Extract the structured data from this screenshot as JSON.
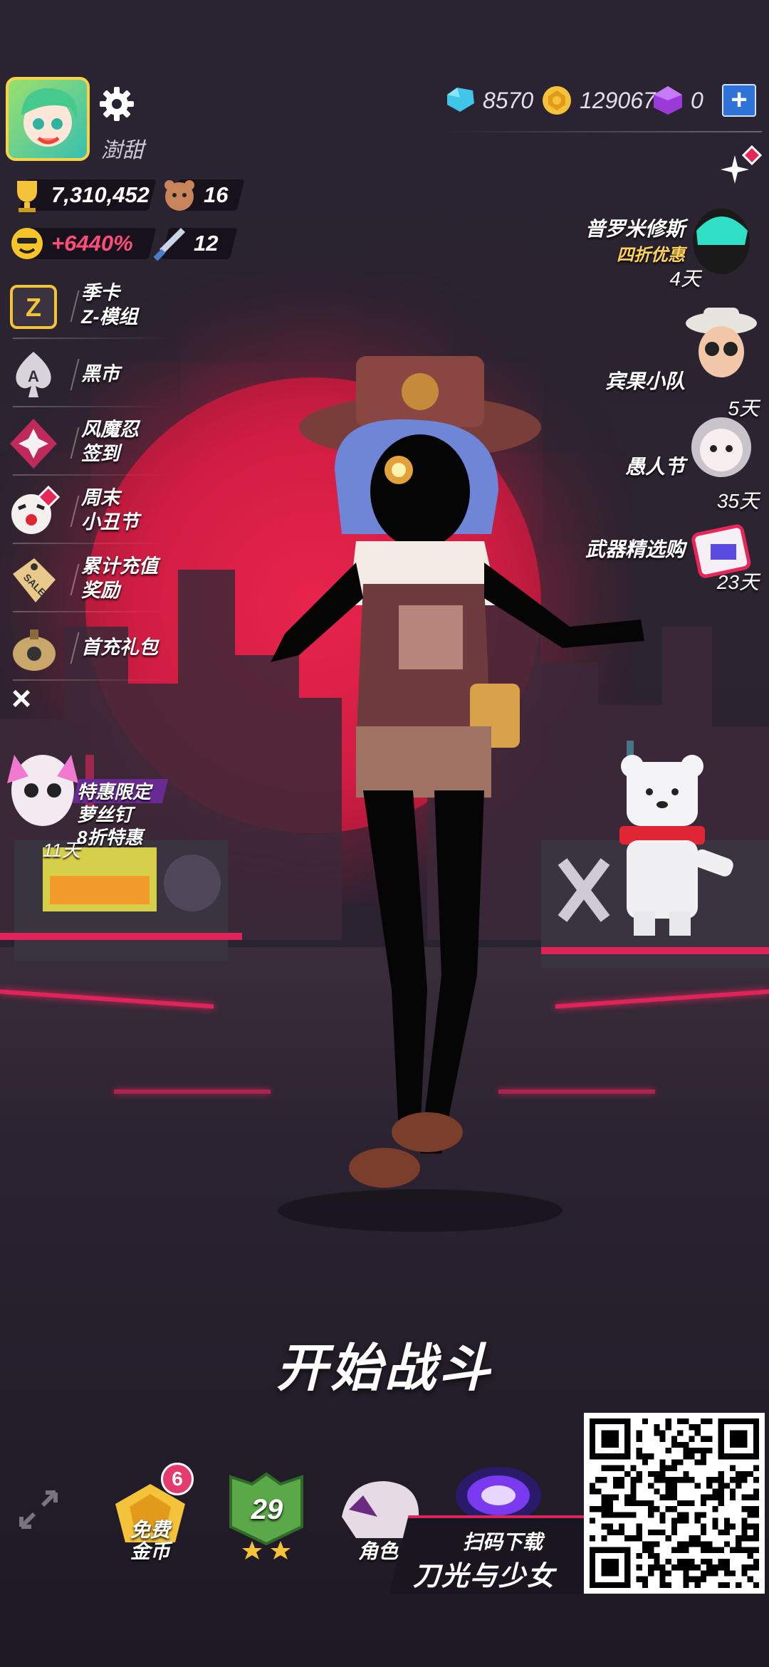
{
  "player": {
    "name": "澍甜"
  },
  "currencies": {
    "gems": "8570",
    "coins": "129067",
    "crystals": "0"
  },
  "stats": {
    "trophies": "7,310,452",
    "pets": "16",
    "bonus": "+6440%",
    "weapons": "12"
  },
  "side_menu": [
    {
      "label": "季卡\nZ-模组",
      "icon": "season-card-icon"
    },
    {
      "label": "黑市",
      "icon": "spade-ace-icon"
    },
    {
      "label": "风魔忍\n签到",
      "icon": "ninja-star-icon"
    },
    {
      "label": "周末\n小丑节",
      "icon": "clown-icon"
    },
    {
      "label": "累计充值\n奖励",
      "icon": "sale-tag-icon"
    },
    {
      "label": "首充礼包",
      "icon": "gift-bag-icon"
    }
  ],
  "promo": {
    "label": "特惠限定\n萝丝钉\n8折特惠",
    "days": "11天"
  },
  "events": [
    {
      "label": "普罗米修斯",
      "sub": "四折优惠",
      "days": "4天",
      "icon": "prometheus-helmet-icon"
    },
    {
      "label": "宾果小队",
      "sub": "",
      "days": "5天",
      "icon": "bingo-squad-icon"
    },
    {
      "label": "愚人节",
      "sub": "",
      "days": "35天",
      "icon": "april-fools-icon"
    },
    {
      "label": "武器精选购",
      "sub": "",
      "days": "23天",
      "icon": "weapon-shop-icon"
    }
  ],
  "battle": {
    "start_label": "开始战斗"
  },
  "bottom": {
    "free_coins_label": "免费\n金币",
    "free_coins_badge": "6",
    "level": "29",
    "role_label": "角色"
  },
  "download": {
    "scan_label": "扫码下载",
    "game_title": "刀光与少女"
  },
  "colors": {
    "accent": "#e0245a",
    "moon": "#d01d43",
    "gold": "#f5c33a",
    "plus_button": "#2f73d8"
  }
}
